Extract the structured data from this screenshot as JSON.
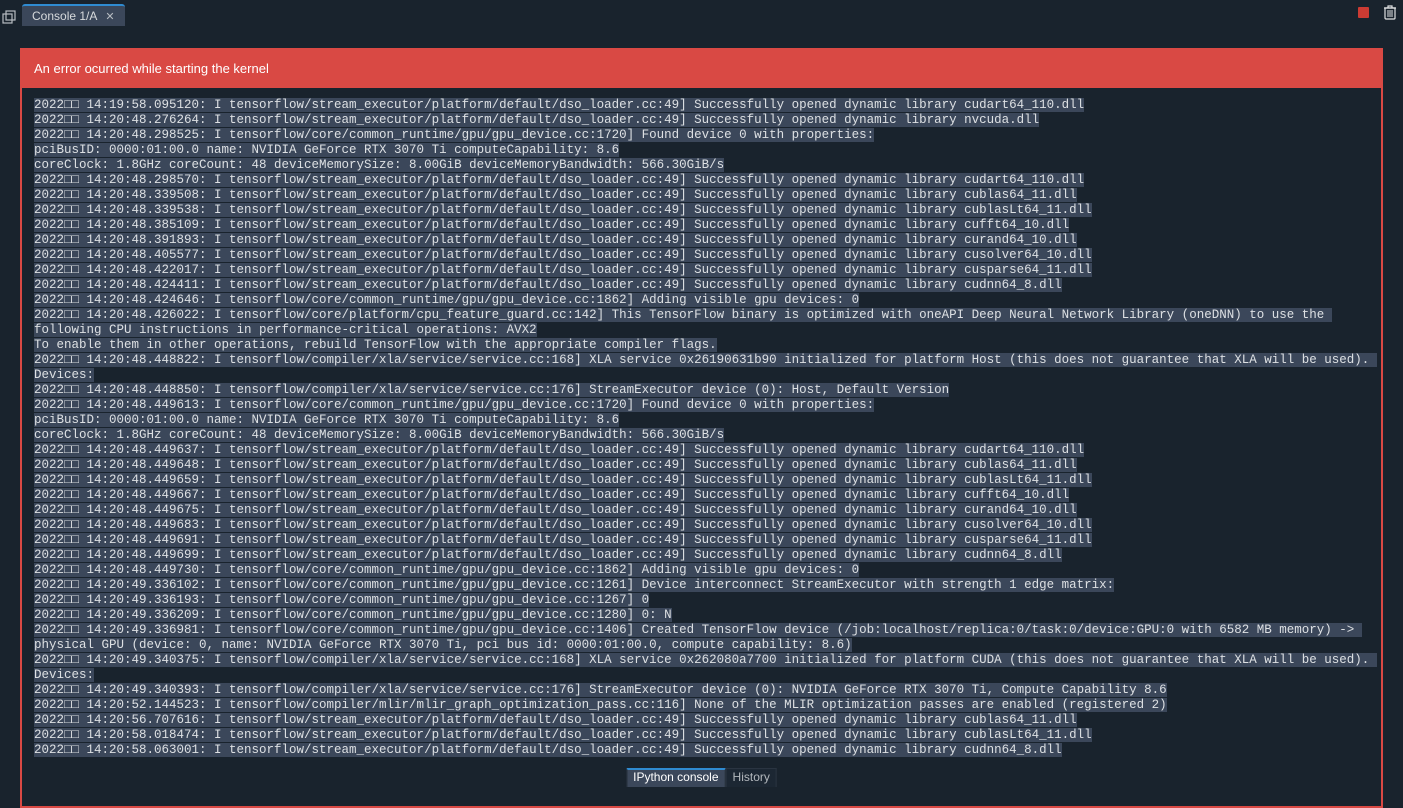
{
  "tab": {
    "label": "Console 1/A"
  },
  "error_banner": {
    "title": "An error ocurred while starting the kernel"
  },
  "console_lines": [
    "2022□□ 14:19:58.095120: I tensorflow/stream_executor/platform/default/dso_loader.cc:49] Successfully opened dynamic library cudart64_110.dll",
    "2022□□ 14:20:48.276264: I tensorflow/stream_executor/platform/default/dso_loader.cc:49] Successfully opened dynamic library nvcuda.dll",
    "2022□□ 14:20:48.298525: I tensorflow/core/common_runtime/gpu/gpu_device.cc:1720] Found device 0 with properties:",
    "pciBusID: 0000:01:00.0 name: NVIDIA GeForce RTX 3070 Ti computeCapability: 8.6",
    "coreClock: 1.8GHz coreCount: 48 deviceMemorySize: 8.00GiB deviceMemoryBandwidth: 566.30GiB/s",
    "2022□□ 14:20:48.298570: I tensorflow/stream_executor/platform/default/dso_loader.cc:49] Successfully opened dynamic library cudart64_110.dll",
    "2022□□ 14:20:48.339508: I tensorflow/stream_executor/platform/default/dso_loader.cc:49] Successfully opened dynamic library cublas64_11.dll",
    "2022□□ 14:20:48.339538: I tensorflow/stream_executor/platform/default/dso_loader.cc:49] Successfully opened dynamic library cublasLt64_11.dll",
    "2022□□ 14:20:48.385109: I tensorflow/stream_executor/platform/default/dso_loader.cc:49] Successfully opened dynamic library cufft64_10.dll",
    "2022□□ 14:20:48.391893: I tensorflow/stream_executor/platform/default/dso_loader.cc:49] Successfully opened dynamic library curand64_10.dll",
    "2022□□ 14:20:48.405577: I tensorflow/stream_executor/platform/default/dso_loader.cc:49] Successfully opened dynamic library cusolver64_10.dll",
    "2022□□ 14:20:48.422017: I tensorflow/stream_executor/platform/default/dso_loader.cc:49] Successfully opened dynamic library cusparse64_11.dll",
    "2022□□ 14:20:48.424411: I tensorflow/stream_executor/platform/default/dso_loader.cc:49] Successfully opened dynamic library cudnn64_8.dll",
    "2022□□ 14:20:48.424646: I tensorflow/core/common_runtime/gpu/gpu_device.cc:1862] Adding visible gpu devices: 0",
    "2022□□ 14:20:48.426022: I tensorflow/core/platform/cpu_feature_guard.cc:142] This TensorFlow binary is optimized with oneAPI Deep Neural Network Library (oneDNN) to use the following CPU instructions in performance‑critical operations: AVX2",
    "To enable them in other operations, rebuild TensorFlow with the appropriate compiler flags.",
    "2022□□ 14:20:48.448822: I tensorflow/compiler/xla/service/service.cc:168] XLA service 0x26190631b90 initialized for platform Host (this does not guarantee that XLA will be used). Devices:",
    "2022□□ 14:20:48.448850: I tensorflow/compiler/xla/service/service.cc:176] StreamExecutor device (0): Host, Default Version",
    "2022□□ 14:20:48.449613: I tensorflow/core/common_runtime/gpu/gpu_device.cc:1720] Found device 0 with properties:",
    "pciBusID: 0000:01:00.0 name: NVIDIA GeForce RTX 3070 Ti computeCapability: 8.6",
    "coreClock: 1.8GHz coreCount: 48 deviceMemorySize: 8.00GiB deviceMemoryBandwidth: 566.30GiB/s",
    "2022□□ 14:20:48.449637: I tensorflow/stream_executor/platform/default/dso_loader.cc:49] Successfully opened dynamic library cudart64_110.dll",
    "2022□□ 14:20:48.449648: I tensorflow/stream_executor/platform/default/dso_loader.cc:49] Successfully opened dynamic library cublas64_11.dll",
    "2022□□ 14:20:48.449659: I tensorflow/stream_executor/platform/default/dso_loader.cc:49] Successfully opened dynamic library cublasLt64_11.dll",
    "2022□□ 14:20:48.449667: I tensorflow/stream_executor/platform/default/dso_loader.cc:49] Successfully opened dynamic library cufft64_10.dll",
    "2022□□ 14:20:48.449675: I tensorflow/stream_executor/platform/default/dso_loader.cc:49] Successfully opened dynamic library curand64_10.dll",
    "2022□□ 14:20:48.449683: I tensorflow/stream_executor/platform/default/dso_loader.cc:49] Successfully opened dynamic library cusolver64_10.dll",
    "2022□□ 14:20:48.449691: I tensorflow/stream_executor/platform/default/dso_loader.cc:49] Successfully opened dynamic library cusparse64_11.dll",
    "2022□□ 14:20:48.449699: I tensorflow/stream_executor/platform/default/dso_loader.cc:49] Successfully opened dynamic library cudnn64_8.dll",
    "2022□□ 14:20:48.449730: I tensorflow/core/common_runtime/gpu/gpu_device.cc:1862] Adding visible gpu devices: 0",
    "2022□□ 14:20:49.336102: I tensorflow/core/common_runtime/gpu/gpu_device.cc:1261] Device interconnect StreamExecutor with strength 1 edge matrix:",
    "2022□□ 14:20:49.336193: I tensorflow/core/common_runtime/gpu/gpu_device.cc:1267] 0",
    "2022□□ 14:20:49.336209: I tensorflow/core/common_runtime/gpu/gpu_device.cc:1280] 0: N",
    "2022□□ 14:20:49.336981: I tensorflow/core/common_runtime/gpu/gpu_device.cc:1406] Created TensorFlow device (/job:localhost/replica:0/task:0/device:GPU:0 with 6582 MB memory) ‑> physical GPU (device: 0, name: NVIDIA GeForce RTX 3070 Ti, pci bus id: 0000:01:00.0, compute capability: 8.6)",
    "2022□□ 14:20:49.340375: I tensorflow/compiler/xla/service/service.cc:168] XLA service 0x262080a7700 initialized for platform CUDA (this does not guarantee that XLA will be used). Devices:",
    "2022□□ 14:20:49.340393: I tensorflow/compiler/xla/service/service.cc:176] StreamExecutor device (0): NVIDIA GeForce RTX 3070 Ti, Compute Capability 8.6",
    "2022□□ 14:20:52.144523: I tensorflow/compiler/mlir/mlir_graph_optimization_pass.cc:116] None of the MLIR optimization passes are enabled (registered 2)",
    "2022□□ 14:20:56.707616: I tensorflow/stream_executor/platform/default/dso_loader.cc:49] Successfully opened dynamic library cublas64_11.dll",
    "2022□□ 14:20:58.018474: I tensorflow/stream_executor/platform/default/dso_loader.cc:49] Successfully opened dynamic library cublasLt64_11.dll",
    "2022□□ 14:20:58.063001: I tensorflow/stream_executor/platform/default/dso_loader.cc:49] Successfully opened dynamic library cudnn64_8.dll"
  ],
  "bottom_tabs": {
    "active": "IPython console",
    "inactive": "History"
  }
}
